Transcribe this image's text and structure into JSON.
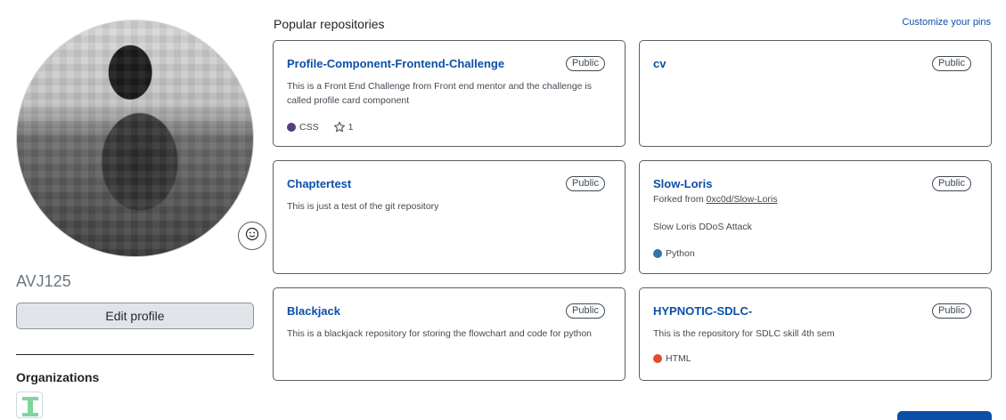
{
  "profile": {
    "username": "AVJ125",
    "edit_label": "Edit profile",
    "organizations_title": "Organizations"
  },
  "popular": {
    "title": "Popular repositories",
    "customize_label": "Customize your pins"
  },
  "repos": [
    {
      "name": "Profile-Component-Frontend-Challenge",
      "visibility": "Public",
      "description": "This is a Front End Challenge from Front end mentor and the challenge is called profile card component",
      "language": "CSS",
      "language_color": "#563d7c",
      "stars": "1"
    },
    {
      "name": "cv",
      "visibility": "Public"
    },
    {
      "name": "Chaptertest",
      "visibility": "Public",
      "description": "This is just a test of the git repository"
    },
    {
      "name": "Slow-Loris",
      "visibility": "Public",
      "forked_prefix": "Forked from ",
      "forked_from": "0xc0d/Slow-Loris",
      "description": "Slow Loris DDoS Attack",
      "language": "Python",
      "language_color": "#3572A5"
    },
    {
      "name": "Blackjack",
      "visibility": "Public",
      "description": "This is a blackjack repository for storing the flowchart and code for python"
    },
    {
      "name": "HYPNOTIC-SDLC-",
      "visibility": "Public",
      "description": "This is the repository for SDLC skill 4th sem",
      "language": "HTML",
      "language_color": "#e34c26"
    }
  ],
  "icons": {
    "emoji": "smiley-icon",
    "star": "star-icon"
  }
}
